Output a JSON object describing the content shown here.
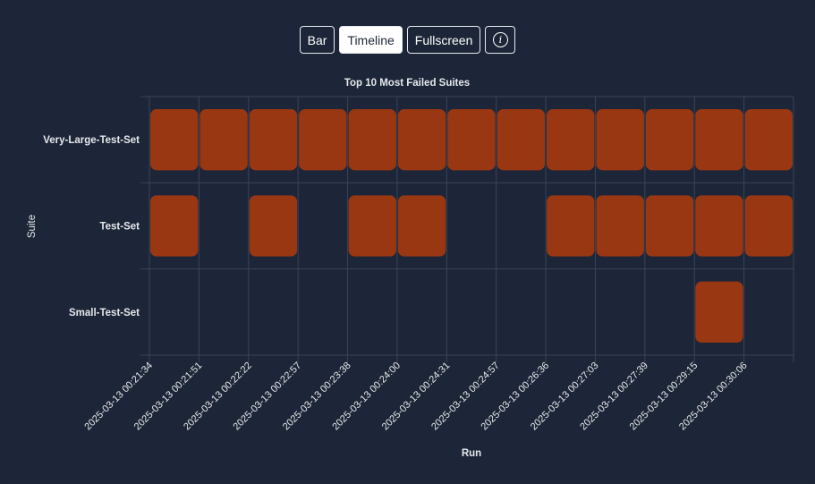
{
  "toolbar": {
    "buttons": [
      {
        "label": "Bar",
        "active": false
      },
      {
        "label": "Timeline",
        "active": true
      },
      {
        "label": "Fullscreen",
        "active": false
      }
    ],
    "info_icon": "info-icon",
    "info_glyph": "i"
  },
  "colors": {
    "background": "#1d2638",
    "bar": "#983712",
    "grid": "#3a4456",
    "text": "#e6e8ec"
  },
  "chart_data": {
    "type": "timeline",
    "title": "Top 10 Most Failed Suites",
    "xlabel": "Run",
    "ylabel": "Suite",
    "grid": true,
    "categories": [
      "Very-Large-Test-Set",
      "Test-Set",
      "Small-Test-Set"
    ],
    "x": [
      "2025-03-13 00:21:34",
      "2025-03-13 00:21:51",
      "2025-03-13 00:22:22",
      "2025-03-13 00:22:57",
      "2025-03-13 00:23:38",
      "2025-03-13 00:24:00",
      "2025-03-13 00:24:31",
      "2025-03-13 00:24:57",
      "2025-03-13 00:26:36",
      "2025-03-13 00:27:03",
      "2025-03-13 00:27:39",
      "2025-03-13 00:29:15",
      "2025-03-13 00:30:06"
    ],
    "failures": [
      {
        "suite": "Very-Large-Test-Set",
        "runs": [
          0,
          1,
          2,
          3,
          4,
          5,
          6,
          7,
          8,
          9,
          10,
          11,
          12
        ]
      },
      {
        "suite": "Test-Set",
        "runs": [
          0,
          2,
          4,
          5,
          8,
          9,
          10,
          11,
          12
        ]
      },
      {
        "suite": "Small-Test-Set",
        "runs": [
          11
        ]
      }
    ]
  }
}
